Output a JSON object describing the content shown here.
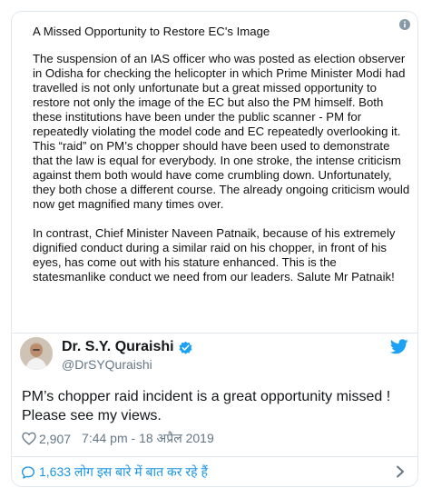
{
  "document": {
    "title": "A Missed Opportunity to Restore EC's Image",
    "paragraphs": [
      "The suspension of an IAS officer who was posted as election observer\nin Odisha for checking the helicopter in which Prime Minister Modi had\ntravelled is not only unfortunate but a great missed opportunity to\nrestore not only the image of the EC but also the PM himself. Both\nthese institutions have been under the public scanner - PM for\nrepeatedly violating the model code and EC repeatedly overlooking it.\nThis “raid” on PM’s chopper should have been used to demonstrate\nthat the law is equal for everybody. In one stroke, the intense criticism\nagainst them both would have come crumbling down. Unfortunately,\nthey both chose a different course. The already ongoing criticism would\nnow get magnified many times over.",
      "In contrast, Chief Minister Naveen Patnaik, because of his extremely\ndignified conduct  during a similar raid on his chopper, in front of his\neyes,  has come out with his stature enhanced.  This is the\nstatesmanlike conduct we need from our leaders. Salute Mr Patnaik!"
    ]
  },
  "author": {
    "name": "Dr. S.Y. Quraishi",
    "handle": "@DrSYQuraishi"
  },
  "tweet": {
    "text": "PM’s chopper raid incident is a great opportunity missed ! Please see my views.",
    "likes": "2,907",
    "timestamp": "7:44 pm - 18 अप्रैल 2019"
  },
  "footer": {
    "conversation_label": "1,633 लोग इस बारे में बात कर रहे हैं"
  },
  "colors": {
    "link": "#1b95e0",
    "muted": "#657786",
    "border": "#e1e8ed"
  },
  "icons": [
    "info-icon",
    "verified-badge-icon",
    "twitter-bird-icon",
    "heart-icon",
    "speech-bubble-icon",
    "chevron-right-icon"
  ]
}
